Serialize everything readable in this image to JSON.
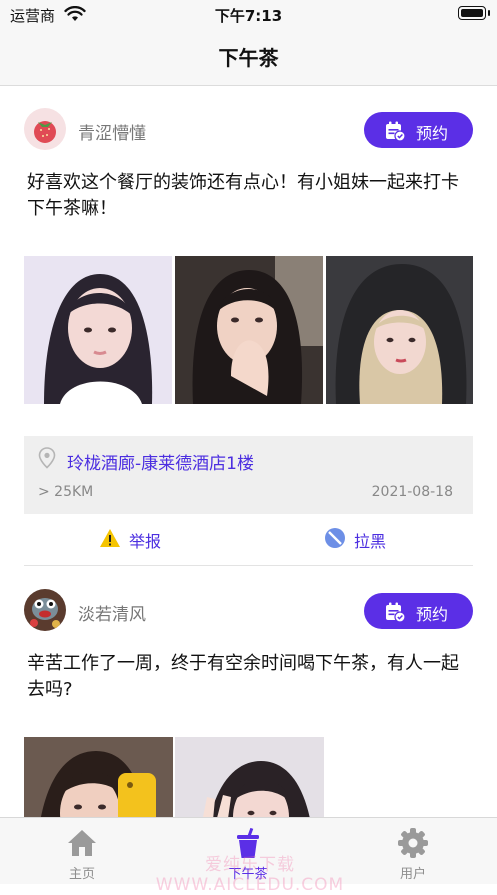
{
  "status_bar": {
    "carrier": "运营商",
    "time": "下午7:13"
  },
  "nav": {
    "title": "下午茶"
  },
  "colors": {
    "accent": "#5b2fe6",
    "link": "#4b2ee0",
    "muted": "#777777",
    "warning": "#f5c400",
    "block_icon": "#6d8fe6"
  },
  "posts": [
    {
      "username": "青涩懵懂",
      "avatar_icon": "strawberry-avatar",
      "book_label": "预约",
      "book_icon": "calendar-check-icon",
      "text": "好喜欢这个餐厅的装饰还有点心！有小姐妹一起来打卡下午茶嘛！",
      "photos": [
        "portrait-photo",
        "portrait-photo",
        "portrait-photo"
      ],
      "location": {
        "icon": "location-pin-icon",
        "place": "玲栊酒廊-康莱德酒店1楼",
        "distance": "> 25KM",
        "date": "2021-08-18"
      },
      "actions": {
        "report_label": "举报",
        "report_icon": "warning-icon",
        "block_label": "拉黑",
        "block_icon": "block-icon"
      }
    },
    {
      "username": "淡若清风",
      "avatar_icon": "cartoon-avatar",
      "book_label": "预约",
      "book_icon": "calendar-check-icon",
      "text": "辛苦工作了一周，终于有空余时间喝下午茶，有人一起去吗?",
      "photos": [
        "portrait-photo",
        "portrait-photo"
      ]
    }
  ],
  "tabs": [
    {
      "label": "主页",
      "icon": "home-icon",
      "active": false
    },
    {
      "label": "下午茶",
      "icon": "cup-icon",
      "active": true
    },
    {
      "label": "用户",
      "icon": "gear-icon",
      "active": false
    }
  ],
  "watermark": "爱纯乐下载 WWW.AICLEDU.COM"
}
